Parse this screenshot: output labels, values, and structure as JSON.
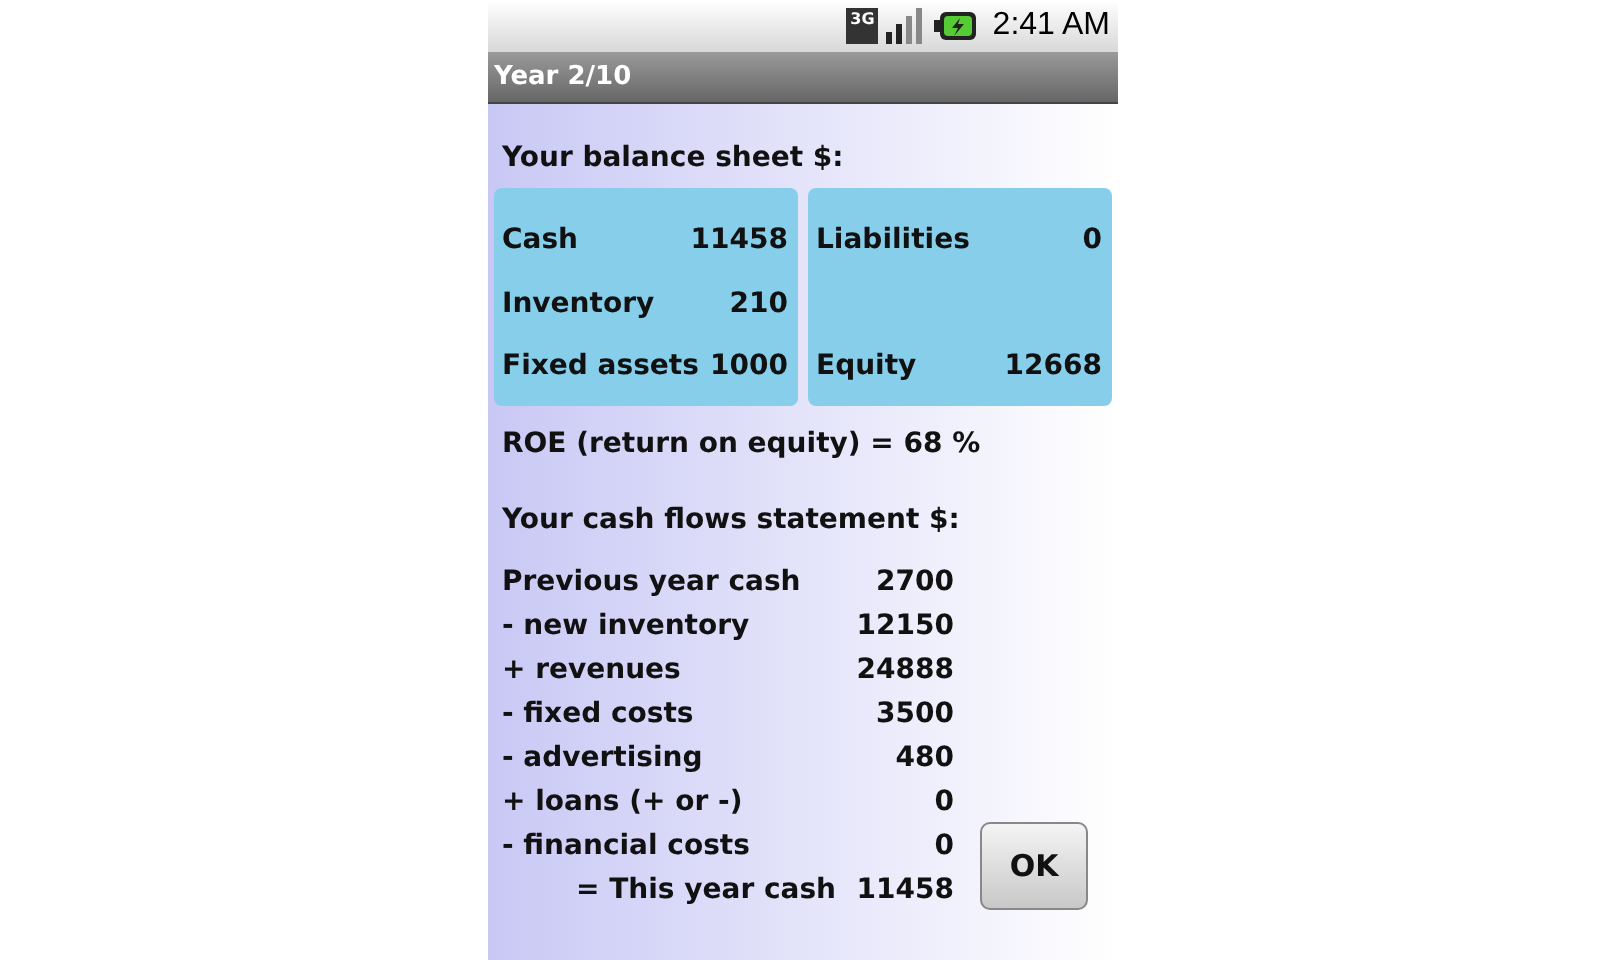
{
  "status_bar": {
    "network": "3G",
    "time": "2:41 AM"
  },
  "window": {
    "title": "Year 2/10"
  },
  "balance_sheet": {
    "heading": "Your balance sheet $:",
    "assets": [
      {
        "label": "Cash",
        "value": "11458"
      },
      {
        "label": "Inventory",
        "value": "210"
      },
      {
        "label": "Fixed assets",
        "value": "1000"
      }
    ],
    "liabilities": [
      {
        "label": "Liabilities",
        "value": "0"
      },
      {
        "label": "Equity",
        "value": "12668"
      }
    ]
  },
  "roe": "ROE (return on equity) = 68 %",
  "cash_flows": {
    "heading": "Your cash flows statement $:",
    "rows": [
      {
        "kind": "item",
        "label": "Previous year cash",
        "value": "2700"
      },
      {
        "kind": "item",
        "label": "- new inventory",
        "value": "12150"
      },
      {
        "kind": "item",
        "label": "+ revenues",
        "value": "24888"
      },
      {
        "kind": "item",
        "label": "- fixed costs",
        "value": "3500"
      },
      {
        "kind": "item",
        "label": "- advertising",
        "value": "480"
      },
      {
        "kind": "item",
        "label": "+ loans (+ or -)",
        "value": "0"
      },
      {
        "kind": "item",
        "label": "- financial costs",
        "value": "0"
      },
      {
        "kind": "total",
        "label": "= This year cash",
        "value": "11458"
      }
    ]
  },
  "buttons": [
    "OK"
  ]
}
